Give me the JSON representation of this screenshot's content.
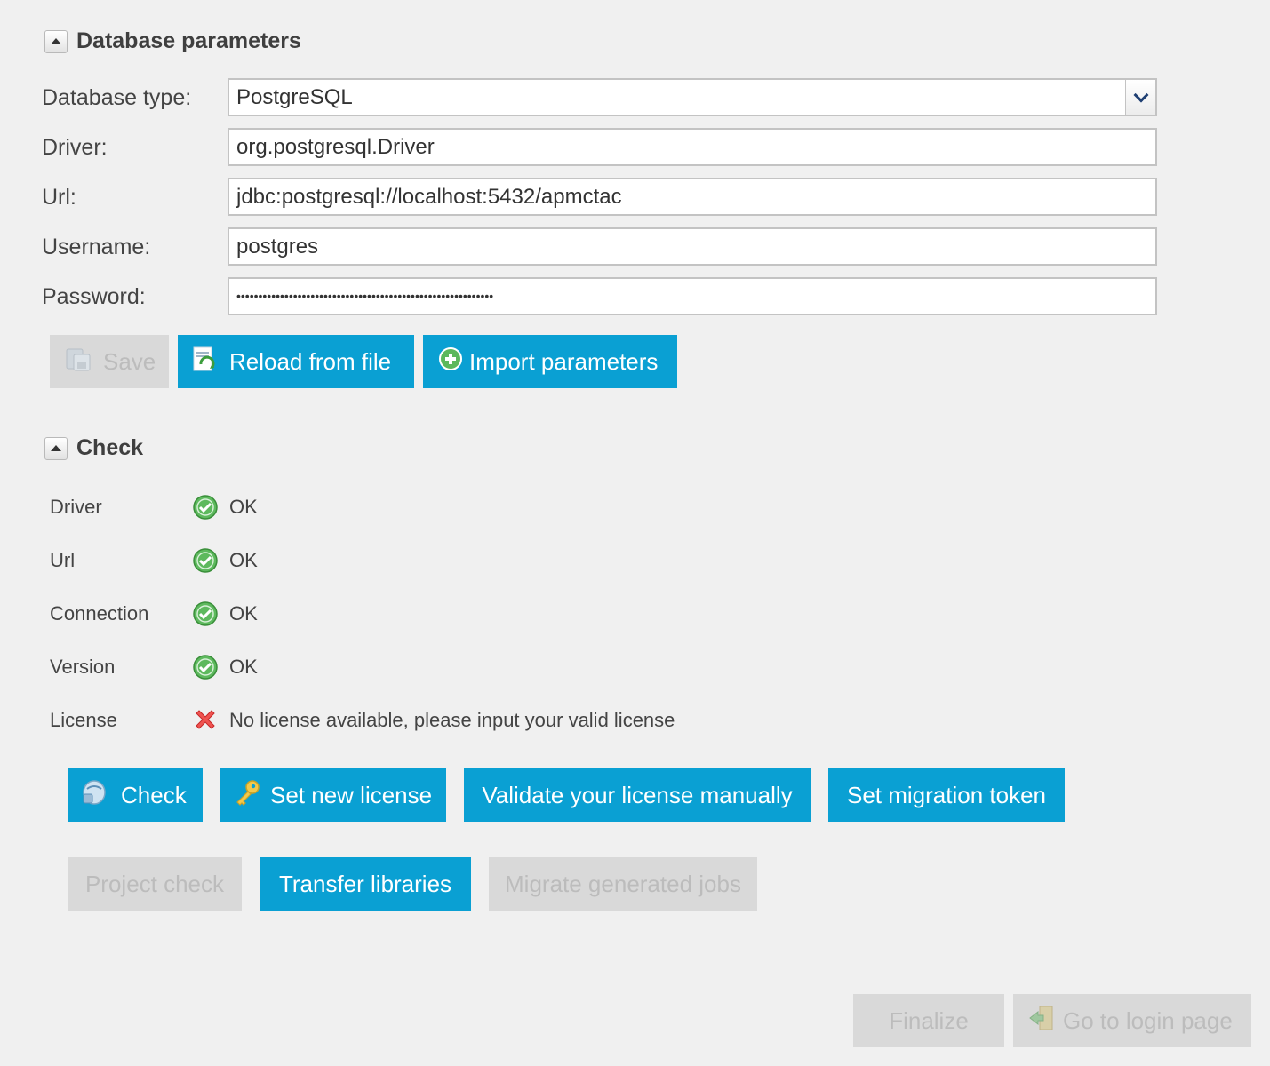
{
  "database_section": {
    "title": "Database parameters",
    "fields": {
      "db_type": {
        "label": "Database type:",
        "value": "PostgreSQL"
      },
      "driver": {
        "label": "Driver:",
        "value": "org.postgresql.Driver"
      },
      "url": {
        "label": "Url:",
        "value": "jdbc:postgresql://localhost:5432/apmctac"
      },
      "username": {
        "label": "Username:",
        "value": "postgres"
      },
      "password": {
        "label": "Password:",
        "value": "•••••••••••••••••••••••••••••••••••••••••••••••••••••••••••"
      }
    },
    "buttons": {
      "save": {
        "label": "Save",
        "icon": "save-icon",
        "enabled": false
      },
      "reload": {
        "label": "Reload from file",
        "icon": "reload-file-icon",
        "enabled": true
      },
      "import": {
        "label": "Import parameters",
        "icon": "add-circle-icon",
        "enabled": true
      }
    }
  },
  "check_section": {
    "title": "Check",
    "rows": [
      {
        "label": "Driver",
        "status": "ok",
        "icon": "check-circle-icon",
        "text": "OK"
      },
      {
        "label": "Url",
        "status": "ok",
        "icon": "check-circle-icon",
        "text": "OK"
      },
      {
        "label": "Connection",
        "status": "ok",
        "icon": "check-circle-icon",
        "text": "OK"
      },
      {
        "label": "Version",
        "status": "ok",
        "icon": "check-circle-icon",
        "text": "OK"
      },
      {
        "label": "License",
        "status": "error",
        "icon": "error-x-icon",
        "text": "No license available, please input your valid license"
      }
    ],
    "buttons": {
      "check": {
        "label": "Check",
        "icon": "check-db-icon",
        "enabled": true
      },
      "set_license": {
        "label": "Set new license",
        "icon": "key-icon",
        "enabled": true
      },
      "validate": {
        "label": "Validate your license manually",
        "enabled": true
      },
      "migration_token": {
        "label": "Set migration token",
        "enabled": true
      },
      "project_check": {
        "label": "Project check",
        "enabled": false
      },
      "transfer": {
        "label": "Transfer libraries",
        "enabled": true
      },
      "migrate_jobs": {
        "label": "Migrate generated jobs",
        "enabled": false
      }
    }
  },
  "footer": {
    "finalize": {
      "label": "Finalize",
      "enabled": false
    },
    "login": {
      "label": "Go to login page",
      "icon": "login-door-icon",
      "enabled": false
    }
  },
  "colors": {
    "primary_button": "#0aa0d3",
    "disabled_button": "#d9d9d9",
    "ok": "#4caf50",
    "error": "#e53935",
    "background": "#f0f0f0"
  }
}
